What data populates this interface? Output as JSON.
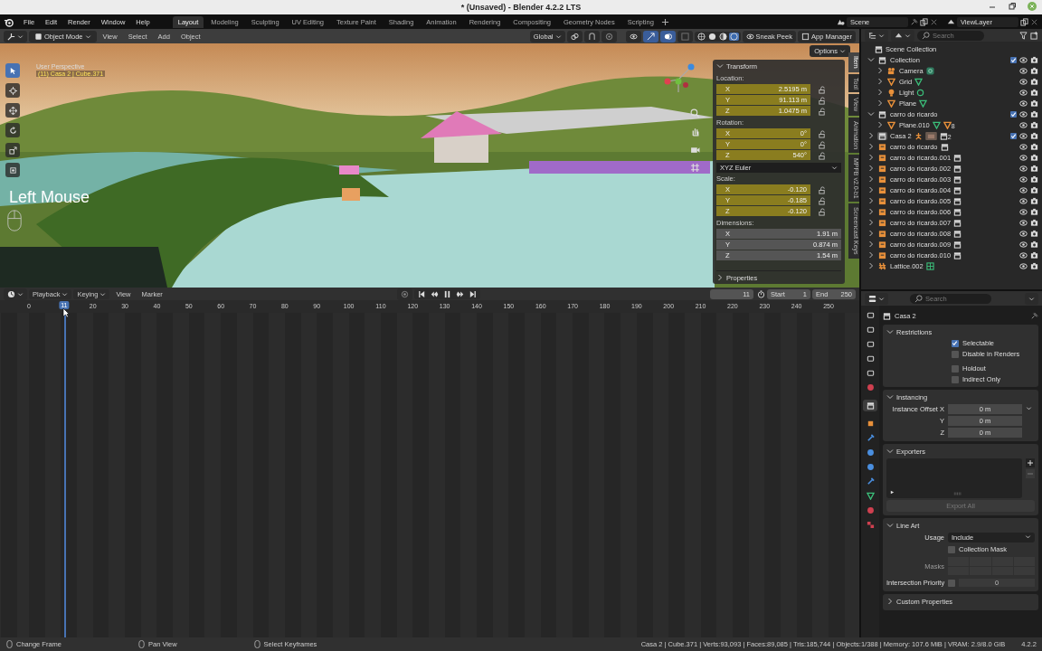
{
  "window": {
    "title": "* (Unsaved) - Blender 4.2.2 LTS"
  },
  "menu": [
    "File",
    "Edit",
    "Render",
    "Window",
    "Help"
  ],
  "workspaces": [
    {
      "label": "Layout",
      "selected": true
    },
    {
      "label": "Modeling",
      "selected": false
    },
    {
      "label": "Sculpting",
      "selected": false
    },
    {
      "label": "UV Editing",
      "selected": false
    },
    {
      "label": "Texture Paint",
      "selected": false
    },
    {
      "label": "Shading",
      "selected": false
    },
    {
      "label": "Animation",
      "selected": false
    },
    {
      "label": "Rendering",
      "selected": false
    },
    {
      "label": "Compositing",
      "selected": false
    },
    {
      "label": "Geometry Nodes",
      "selected": false
    },
    {
      "label": "Scripting",
      "selected": false
    }
  ],
  "scene": "Scene",
  "view_layer": "ViewLayer",
  "viewport": {
    "mode": "Object Mode",
    "menus": [
      "View",
      "Select",
      "Add",
      "Object"
    ],
    "orientation": "Global",
    "shading": [
      {
        "kind": "wireframe",
        "selected": false
      },
      {
        "kind": "solid",
        "selected": false
      },
      {
        "kind": "material",
        "selected": false
      },
      {
        "kind": "rendered",
        "selected": true
      }
    ],
    "buttons": [
      "Sneak Peek",
      "App Manager"
    ],
    "options": "Options",
    "tools": [
      {
        "kind": "select",
        "selected": true
      },
      {
        "kind": "cursor",
        "selected": false
      },
      {
        "kind": "move",
        "selected": false
      },
      {
        "kind": "rotate",
        "selected": false
      },
      {
        "kind": "scale",
        "selected": false
      },
      {
        "kind": "transform",
        "selected": false
      }
    ],
    "view_name": "User Perspective",
    "object_info": "(11) Casa 2 | Cube.371",
    "key_overlay": "Left Mouse"
  },
  "sidebar": {
    "tabs": [
      {
        "label": "Item",
        "selected": true
      },
      {
        "label": "Tool",
        "selected": false
      },
      {
        "label": "View",
        "selected": false
      },
      {
        "label": "Animation",
        "selected": false
      },
      {
        "label": "MPFB v2.0-b1",
        "selected": false
      },
      {
        "label": "Screencast Keys",
        "selected": false
      }
    ],
    "panel": "Transform",
    "groups": [
      {
        "label": "Location:",
        "kind": "keyed",
        "fields": [
          {
            "axis": "X",
            "value": "2.5195 m"
          },
          {
            "axis": "Y",
            "value": "91.113 m"
          },
          {
            "axis": "Z",
            "value": "1.0475 m"
          }
        ]
      },
      {
        "label": "Rotation:",
        "kind": "keyed",
        "fields": [
          {
            "axis": "X",
            "value": "0°"
          },
          {
            "axis": "Y",
            "value": "0°"
          },
          {
            "axis": "Z",
            "value": "540°"
          }
        ],
        "mode": "XYZ Euler"
      },
      {
        "label": "Scale:",
        "kind": "keyed",
        "fields": [
          {
            "axis": "X",
            "value": "-0.120"
          },
          {
            "axis": "Y",
            "value": "-0.185"
          },
          {
            "axis": "Z",
            "value": "-0.120"
          }
        ]
      },
      {
        "label": "Dimensions:",
        "kind": "plain",
        "fields": [
          {
            "axis": "X",
            "value": "1.91 m"
          },
          {
            "axis": "Y",
            "value": "0.874 m"
          },
          {
            "axis": "Z",
            "value": "1.54 m"
          }
        ]
      }
    ],
    "collapsed_panel": "Properties"
  },
  "outliner": {
    "search": {
      "placeholder": "Search"
    },
    "root": "Scene Collection",
    "items": [
      {
        "name": "Collection",
        "kind": "collection",
        "expanded": true,
        "checked": true,
        "selected": false,
        "children": [
          {
            "name": "Camera",
            "kind": "camera",
            "expanded": false,
            "selected": false,
            "extras": [
              {
                "kind": "camera-data"
              }
            ]
          },
          {
            "name": "Grid",
            "kind": "mesh",
            "expanded": false,
            "selected": false,
            "extras": [
              {
                "kind": "mesh-data"
              }
            ]
          },
          {
            "name": "Light",
            "kind": "light",
            "expanded": false,
            "selected": false,
            "extras": [
              {
                "kind": "light-data"
              }
            ]
          },
          {
            "name": "Plane",
            "kind": "mesh",
            "expanded": false,
            "selected": false,
            "extras": [
              {
                "kind": "mesh-data"
              }
            ]
          }
        ]
      },
      {
        "name": "carro do ricardo",
        "kind": "collection",
        "expanded": true,
        "checked": true,
        "selected": false,
        "children": [
          {
            "name": "Plane.010",
            "kind": "mesh",
            "expanded": false,
            "selected": false,
            "extras": [
              {
                "kind": "mesh-data"
              },
              {
                "kind": "mesh",
                "count": "8"
              }
            ]
          }
        ]
      },
      {
        "name": "Casa 2",
        "kind": "collection",
        "expanded": false,
        "checked": true,
        "selected": true,
        "extras": [
          {
            "kind": "armature"
          },
          {
            "kind": "thumbnail"
          },
          {
            "kind": "collection",
            "count": "2"
          }
        ]
      },
      {
        "name": "carro do ricardo",
        "kind": "instance",
        "expanded": false,
        "selected": false,
        "extras": [
          {
            "kind": "collection"
          }
        ]
      },
      {
        "name": "carro do ricardo.001",
        "kind": "instance",
        "expanded": false,
        "selected": false,
        "extras": [
          {
            "kind": "collection"
          }
        ]
      },
      {
        "name": "carro do ricardo.002",
        "kind": "instance",
        "expanded": false,
        "selected": false,
        "extras": [
          {
            "kind": "collection"
          }
        ]
      },
      {
        "name": "carro do ricardo.003",
        "kind": "instance",
        "expanded": false,
        "selected": false,
        "extras": [
          {
            "kind": "collection"
          }
        ]
      },
      {
        "name": "carro do ricardo.004",
        "kind": "instance",
        "expanded": false,
        "selected": false,
        "extras": [
          {
            "kind": "collection"
          }
        ]
      },
      {
        "name": "carro do ricardo.005",
        "kind": "instance",
        "expanded": false,
        "selected": false,
        "extras": [
          {
            "kind": "collection"
          }
        ]
      },
      {
        "name": "carro do ricardo.006",
        "kind": "instance",
        "expanded": false,
        "selected": false,
        "extras": [
          {
            "kind": "collection"
          }
        ]
      },
      {
        "name": "carro do ricardo.007",
        "kind": "instance",
        "expanded": false,
        "selected": false,
        "extras": [
          {
            "kind": "collection"
          }
        ]
      },
      {
        "name": "carro do ricardo.008",
        "kind": "instance",
        "expanded": false,
        "selected": false,
        "extras": [
          {
            "kind": "collection"
          }
        ]
      },
      {
        "name": "carro do ricardo.009",
        "kind": "instance",
        "expanded": false,
        "selected": false,
        "extras": [
          {
            "kind": "collection"
          }
        ]
      },
      {
        "name": "carro do ricardo.010",
        "kind": "instance",
        "expanded": false,
        "selected": false,
        "extras": [
          {
            "kind": "collection"
          }
        ]
      },
      {
        "name": "Lattice.002",
        "kind": "lattice",
        "expanded": false,
        "selected": false,
        "extras": [
          {
            "kind": "lattice-data"
          }
        ]
      }
    ]
  },
  "properties": {
    "search": {
      "placeholder": "Search"
    },
    "tabs": [
      {
        "kind": "tool",
        "selected": false
      },
      {
        "kind": "render",
        "selected": false
      },
      {
        "kind": "output",
        "selected": false
      },
      {
        "kind": "view-layer",
        "selected": false
      },
      {
        "kind": "scene",
        "selected": false
      },
      {
        "kind": "world",
        "selected": false
      },
      {
        "kind": "collection",
        "selected": true
      },
      {
        "kind": "object",
        "selected": false
      },
      {
        "kind": "modifiers",
        "selected": false
      },
      {
        "kind": "particles",
        "selected": false
      },
      {
        "kind": "physics",
        "selected": false
      },
      {
        "kind": "constraints",
        "selected": false
      },
      {
        "kind": "data",
        "selected": false
      },
      {
        "kind": "material",
        "selected": false
      },
      {
        "kind": "texture",
        "selected": false
      }
    ],
    "title": "Casa 2",
    "restrictions": {
      "title": "Restrictions",
      "expanded": true,
      "options": [
        {
          "label": "Selectable",
          "checked": true
        },
        {
          "label": "Disable in Renders",
          "checked": false
        },
        {
          "label": "Holdout",
          "checked": false
        },
        {
          "label": "Indirect Only",
          "checked": false
        }
      ]
    },
    "instancing": {
      "title": "Instancing",
      "expanded": true,
      "label": "Instance Offset",
      "fields": [
        {
          "axis": "X",
          "value": "0 m"
        },
        {
          "axis": "Y",
          "value": "0 m"
        },
        {
          "axis": "Z",
          "value": "0 m"
        }
      ]
    },
    "exporters": {
      "title": "Exporters",
      "expanded": true,
      "button": "Export All"
    },
    "line_art": {
      "title": "Line Art",
      "expanded": true,
      "usage_label": "Usage",
      "usage": "Include",
      "collection_mask": {
        "label": "Collection Mask",
        "checked": false
      },
      "masks_label": "Masks",
      "priority": {
        "label": "Intersection Priority",
        "checked": false,
        "value": "0"
      }
    },
    "custom": {
      "title": "Custom Properties",
      "expanded": false
    }
  },
  "timeline": {
    "menus": [
      "Playback",
      "Keying",
      "View",
      "Marker"
    ],
    "current_frame": "11",
    "start_label": "Start",
    "start": "1",
    "end_label": "End",
    "end": "250",
    "playhead_label": "11",
    "ticks": [
      "0",
      "20",
      "30",
      "40",
      "50",
      "60",
      "70",
      "80",
      "90",
      "100",
      "110",
      "120",
      "130",
      "140",
      "150",
      "160",
      "170",
      "180",
      "190",
      "200",
      "210",
      "220",
      "230",
      "240",
      "250"
    ]
  },
  "status": {
    "hints": [
      "Change Frame",
      "Pan View",
      "Select Keyframes"
    ],
    "stats": "Casa 2 | Cube.371 | Verts:93,093 | Faces:89,085 | Tris:185,744 | Objects:1/388 | Memory: 107.6 MiB | VRAM: 2.9/8.0 GiB",
    "version": "4.2.2"
  }
}
